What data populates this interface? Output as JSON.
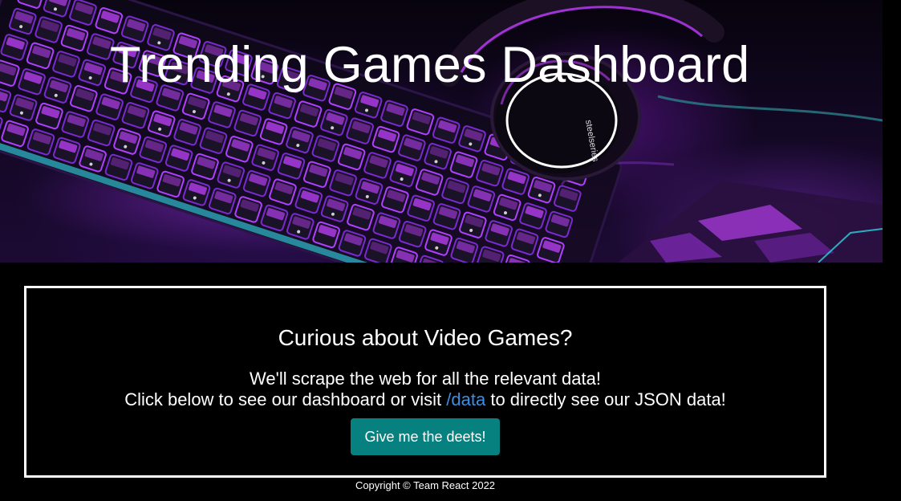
{
  "hero": {
    "title": "Trending Games Dashboard",
    "image_description_icon": "gaming-keyboard-headphones-image"
  },
  "card": {
    "heading": "Curious about Video Games?",
    "line1": "We'll scrape the web for all the relevant data!",
    "line2_before": "Click below to see our dashboard or visit ",
    "link_text": "/data",
    "line2_after": " to directly see our JSON data!",
    "button_label": "Give me the deets!"
  },
  "footer": {
    "copyright": "Copyright © Team React 2022"
  },
  "colors": {
    "background": "#000000",
    "button": "#068180",
    "link": "#3d8ee0",
    "border": "#ffffff",
    "accent_purple": "#b030ff",
    "accent_cyan": "#30e0e8"
  }
}
